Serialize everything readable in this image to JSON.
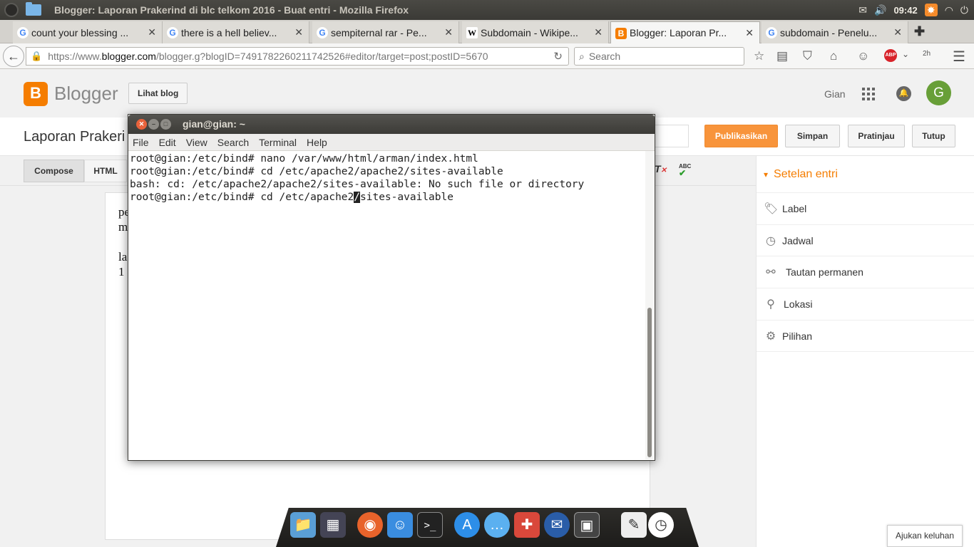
{
  "system": {
    "window_title": "Blogger: Laporan Prakerind di blc telkom 2016 - Buat entri - Mozilla Firefox",
    "clock": "09:42"
  },
  "tabs": [
    {
      "label": "count your blessing ...",
      "favicon": "google-icon"
    },
    {
      "label": "there is a hell believ...",
      "favicon": "google-icon"
    },
    {
      "label": "sempiternal rar - Pe...",
      "favicon": "google-icon"
    },
    {
      "label": "Subdomain - Wikipe...",
      "favicon": "wikipedia-icon"
    },
    {
      "label": "Blogger: Laporan Pr...",
      "favicon": "blogger-icon",
      "active": true
    },
    {
      "label": "subdomain - Penelu...",
      "favicon": "google-icon"
    }
  ],
  "navbar": {
    "url_prefix": "https://www.",
    "url_domain": "blogger.com",
    "url_suffix": "/blogger.g?blogID=7491782260211742526#editor/target=post;postID=5670",
    "search_placeholder": "Search",
    "abp_label": "ABP",
    "ext_badge": "2h"
  },
  "blogger": {
    "brand": "Blogger",
    "view_blog": "Lihat blog",
    "user": "Gian",
    "avatar_letter": "G",
    "post_title": "Laporan Prakeri",
    "buttons": {
      "publish": "Publikasikan",
      "save": "Simpan",
      "preview": "Pratinjau",
      "close": "Tutup"
    },
    "modes": {
      "compose": "Compose",
      "html": "HTML"
    },
    "editor_lines": [
      "pe",
      "m",
      "",
      "la",
      "1"
    ],
    "spell_label": "ABC",
    "sidebar_title": "Setelan entri",
    "sidebar_items": [
      {
        "label": "Label",
        "icon": "tag-icon"
      },
      {
        "label": "Jadwal",
        "icon": "clock-icon"
      },
      {
        "label": "Tautan permanen",
        "icon": "link-icon"
      },
      {
        "label": "Lokasi",
        "icon": "location-pin-icon"
      },
      {
        "label": "Pilihan",
        "icon": "gear-icon"
      }
    ],
    "feedback": "Ajukan keluhan"
  },
  "terminal": {
    "title": "gian@gian: ~",
    "menu": [
      "File",
      "Edit",
      "View",
      "Search",
      "Terminal",
      "Help"
    ],
    "lines": [
      "root@gian:/etc/bind# nano /var/www/html/arman/index.html",
      "root@gian:/etc/bind# cd /etc/apache2/apache2/sites-available",
      "bash: cd: /etc/apache2/apache2/sites-available: No such file or directory"
    ],
    "current_line_before_cursor": "root@gian:/etc/bind# cd /etc/apache2",
    "cursor_char": "/",
    "current_line_after_cursor": "sites-available"
  },
  "colors": {
    "blogger_orange": "#f57d00",
    "publish_button": "#f8943b",
    "avatar_green": "#689f38"
  }
}
